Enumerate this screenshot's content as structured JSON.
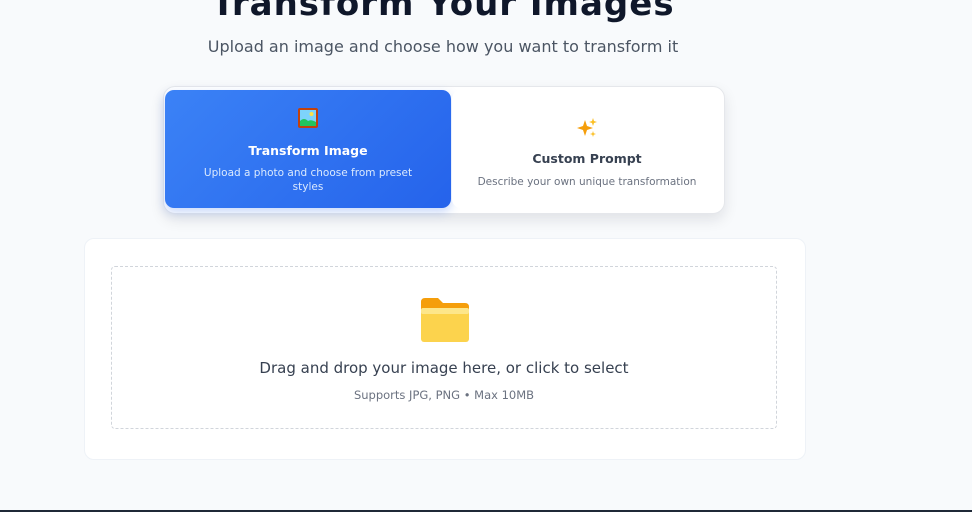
{
  "hero": {
    "title": "Transform Your Images",
    "subtitle": "Upload an image and choose how you want to transform it"
  },
  "modes": [
    {
      "title": "Transform Image",
      "description": "Upload a photo and choose from preset styles",
      "icon": "framed-picture-icon",
      "active": true
    },
    {
      "title": "Custom Prompt",
      "description": "Describe your own unique transformation",
      "icon": "sparkles-icon",
      "active": false
    }
  ],
  "upload": {
    "icon": "folder-icon",
    "prompt": "Drag and drop your image here, or click to select",
    "hint": "Supports JPG, PNG • Max 10MB"
  },
  "colors": {
    "accent": "#2563eb",
    "accent_light": "#3b82f6",
    "background": "#f8fafc",
    "folder": "#fbbf24"
  }
}
